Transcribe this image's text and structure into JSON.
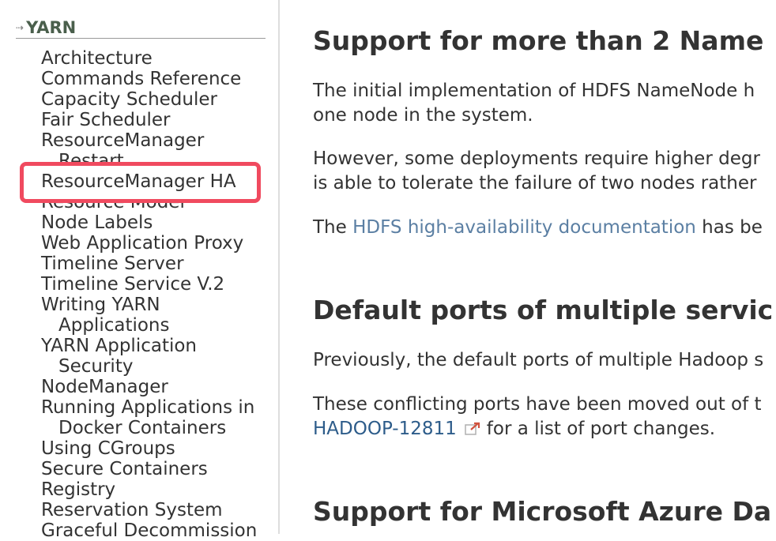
{
  "sidebar": {
    "section_title": "YARN",
    "items": [
      {
        "line1": "Architecture"
      },
      {
        "line1": "Commands Reference"
      },
      {
        "line1": "Capacity Scheduler"
      },
      {
        "line1": "Fair Scheduler"
      },
      {
        "line1": "ResourceManager",
        "line2": "Restart"
      },
      {
        "line1": "ResourceManager HA"
      },
      {
        "line1": "Resource Model"
      },
      {
        "line1": "Node Labels"
      },
      {
        "line1": "Web Application Proxy"
      },
      {
        "line1": "Timeline Server"
      },
      {
        "line1": "Timeline Service V.2"
      },
      {
        "line1": "Writing YARN",
        "line2": "Applications"
      },
      {
        "line1": "YARN Application",
        "line2": "Security"
      },
      {
        "line1": "NodeManager"
      },
      {
        "line1": "Running Applications in",
        "line2": "Docker Containers"
      },
      {
        "line1": "Using CGroups"
      },
      {
        "line1": "Secure Containers"
      },
      {
        "line1": "Registry"
      },
      {
        "line1": "Reservation System"
      },
      {
        "line1": "Graceful Decommission"
      }
    ],
    "highlight_color": "#f04a5f"
  },
  "main": {
    "section1": {
      "heading": "Support for more than 2 Name",
      "p1_line1": "The initial implementation of HDFS NameNode h",
      "p1_line2": "one node in the system.",
      "p2_line1": "However, some deployments require higher degr",
      "p2_line2": "is able to tolerate the failure of two nodes rather",
      "p3_prefix": "The ",
      "p3_link": "HDFS high-availability documentation",
      "p3_suffix": " has be"
    },
    "section2": {
      "heading": "Default ports of multiple servic",
      "p1": "Previously, the default ports of multiple Hadoop s",
      "p2_line1": "These conflicting ports have been moved out of t",
      "p2_link": "HADOOP-12811",
      "p2_suffix": "for a list of port changes."
    },
    "section3": {
      "heading": "Support for Microsoft Azure Da"
    }
  },
  "colors": {
    "link": "#5b7fa3",
    "jira_link": "#2d5c8a",
    "text": "#333333"
  }
}
